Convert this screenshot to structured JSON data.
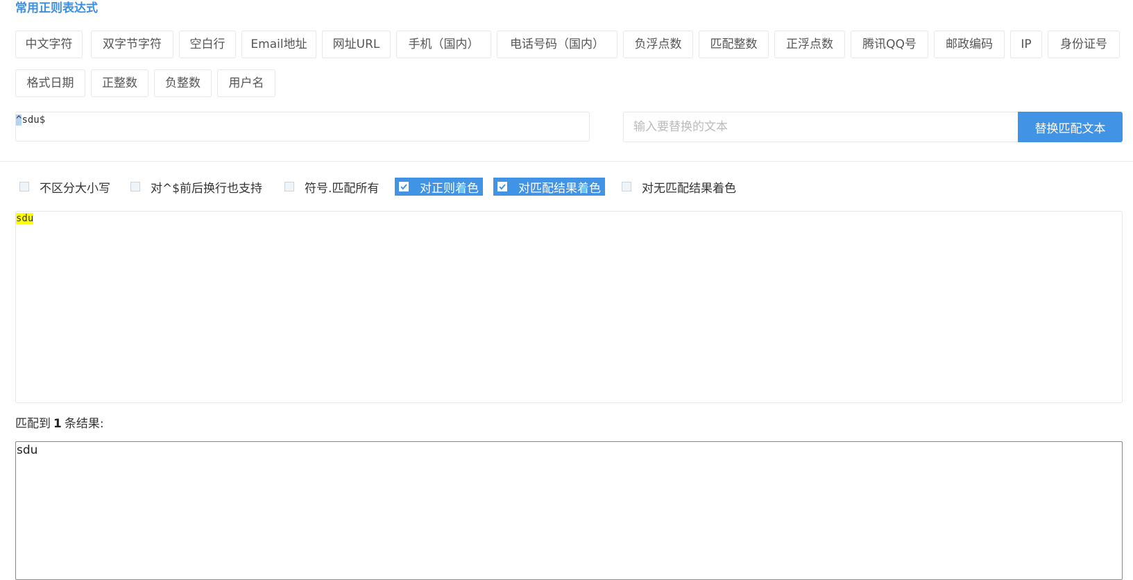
{
  "title": "常用正则表达式",
  "presets": [
    "中文字符",
    "双字节字符",
    "空白行",
    "Email地址",
    "网址URL",
    "手机（国内）",
    "电话号码（国内）",
    "负浮点数",
    "匹配整数",
    "正浮点数",
    "腾讯QQ号",
    "邮政编码",
    "IP",
    "身份证号",
    "格式日期",
    "正整数",
    "负整数",
    "用户名"
  ],
  "regex": {
    "selected": "^",
    "rest": "sdu$"
  },
  "replace": {
    "placeholder": "输入要替换的文本",
    "value": "",
    "button_label": "替换匹配文本"
  },
  "options": [
    {
      "label": "不区分大小写",
      "checked": false
    },
    {
      "label": "对^$前后换行也支持",
      "checked": false
    },
    {
      "label": "符号.匹配所有",
      "checked": false
    },
    {
      "label": "对正则着色",
      "checked": true
    },
    {
      "label": "对匹配结果着色",
      "checked": true
    },
    {
      "label": "对无匹配结果着色",
      "checked": false
    }
  ],
  "test_text": {
    "highlighted": "sdu"
  },
  "summary": {
    "prefix": "匹配到",
    "count": "1",
    "suffix": "条结果:"
  },
  "result_text": "sdu",
  "colors": {
    "accent": "#4193e6",
    "title": "#3b8fe0",
    "highlight": "#ffff00"
  }
}
